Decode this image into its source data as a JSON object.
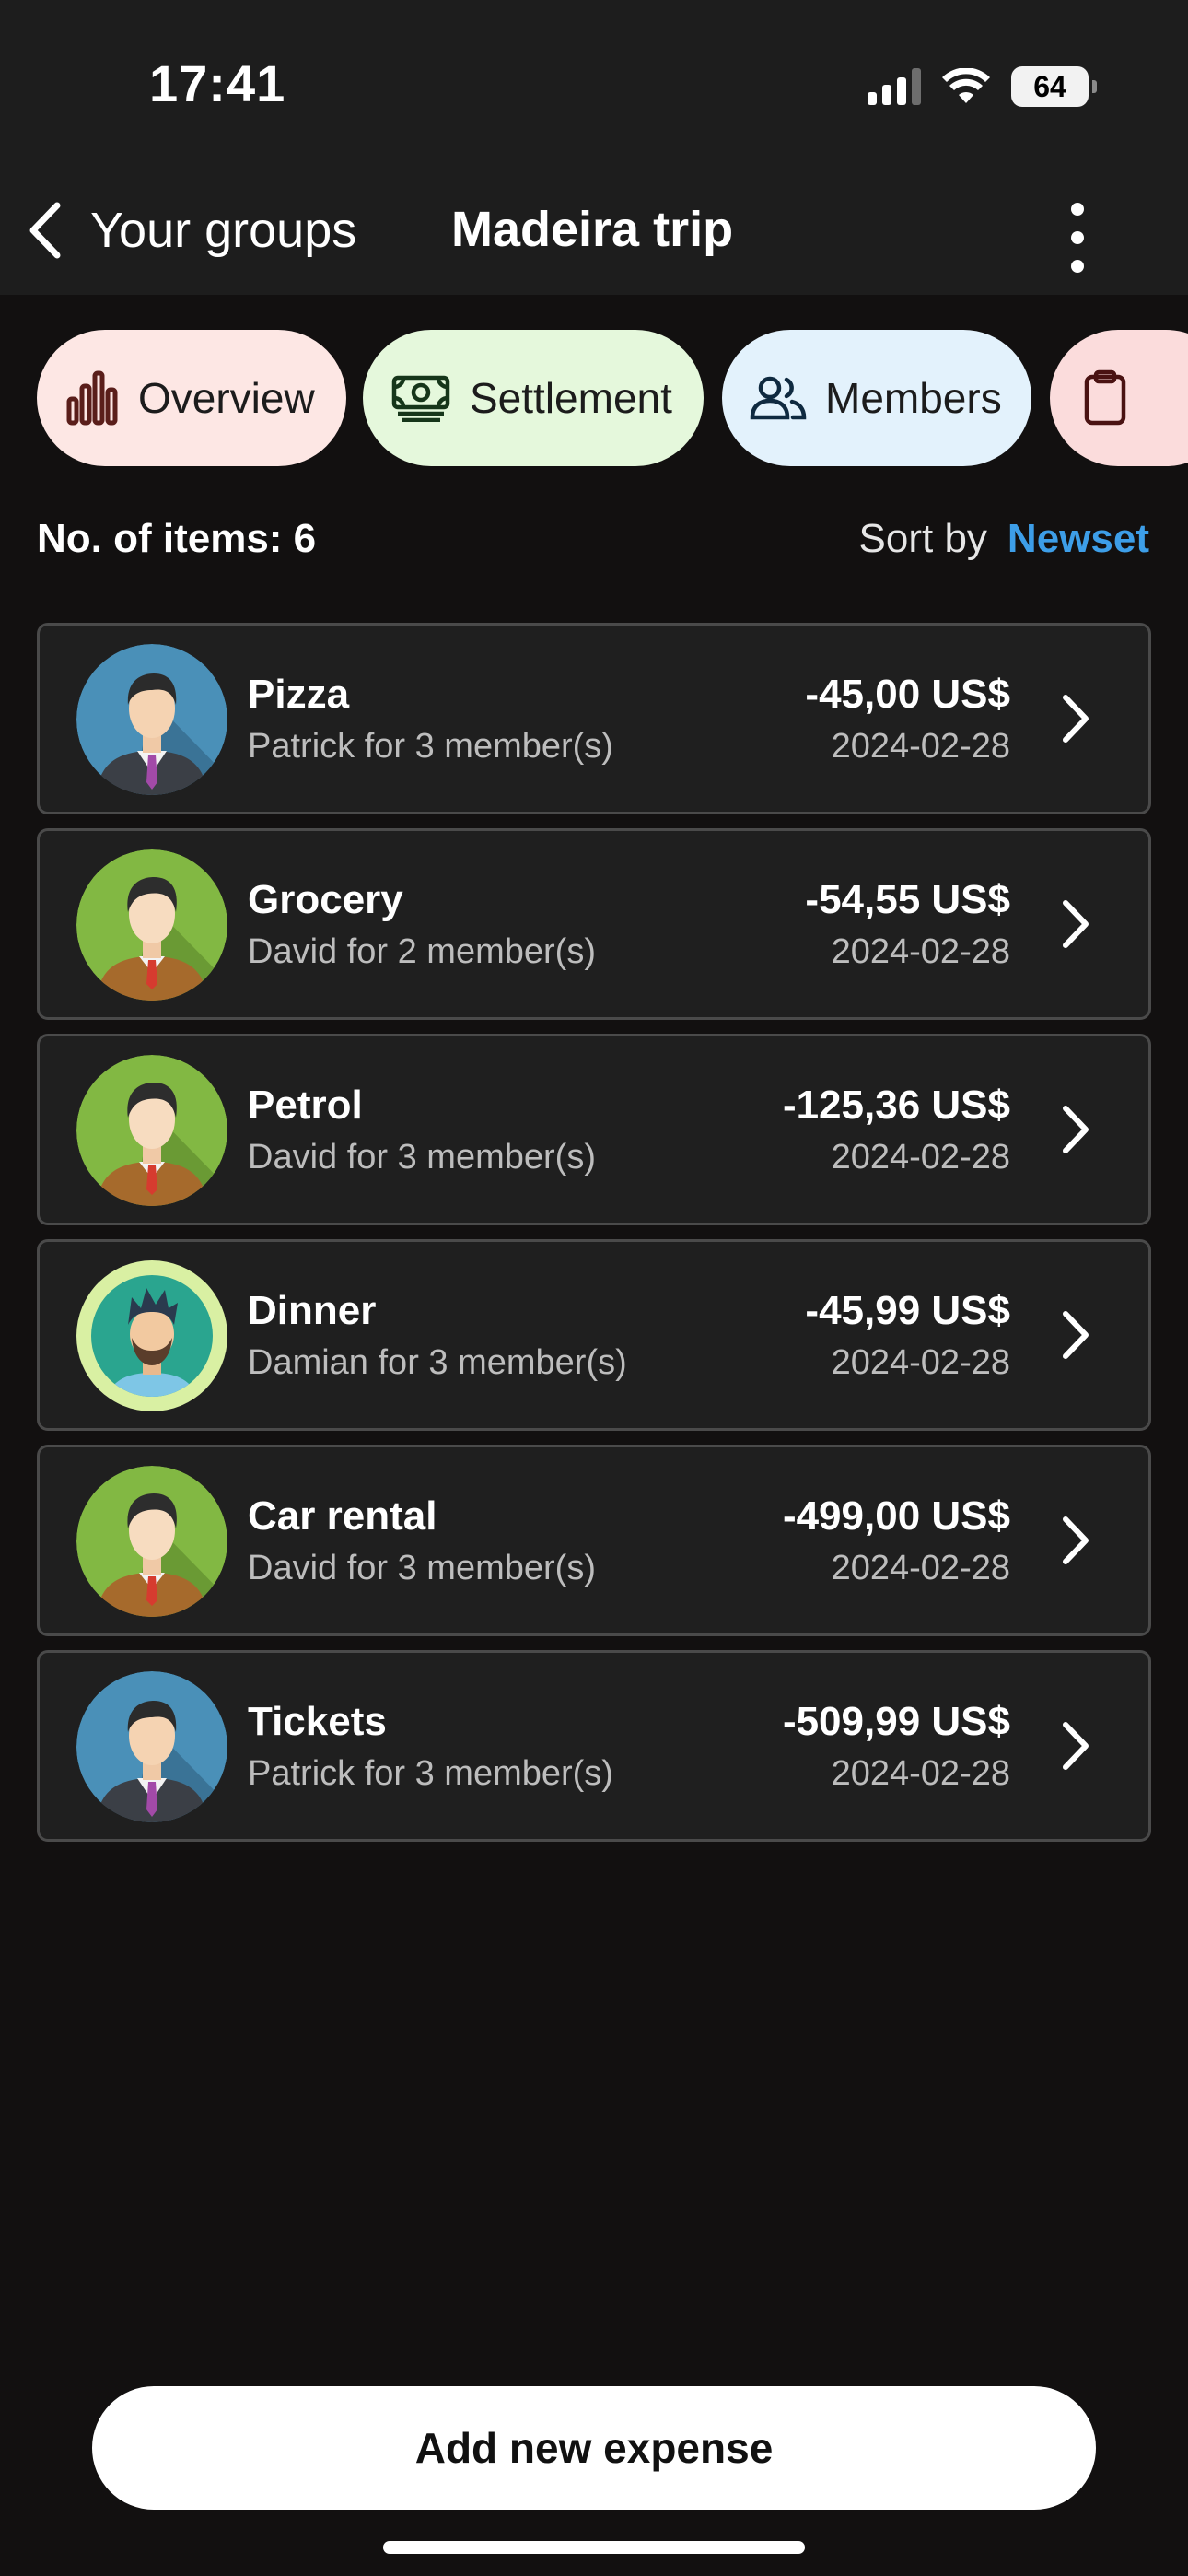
{
  "status_bar": {
    "time": "17:41",
    "battery": "64",
    "signal_icon": "cellular-signal-icon",
    "wifi_icon": "wifi-icon"
  },
  "header": {
    "back_label": "Your groups",
    "title": "Madeira trip",
    "back_icon": "chevron-left-icon",
    "menu_icon": "more-vertical-icon"
  },
  "tabs": [
    {
      "label": "Overview",
      "icon": "bar-chart-icon",
      "color": "#fde7e4"
    },
    {
      "label": "Settlement",
      "icon": "banknote-icon",
      "color": "#e5f8dc"
    },
    {
      "label": "Members",
      "icon": "users-icon",
      "color": "#e3f2fc"
    },
    {
      "label": "",
      "icon": "clipboard-icon",
      "color": "#fbdcdc"
    }
  ],
  "list_header": {
    "count_label": "No. of items: 6",
    "sort_label": "Sort by",
    "sort_value": "Newset"
  },
  "expenses": [
    {
      "title": "Pizza",
      "subtitle": "Patrick for 3 member(s)",
      "amount": "-45,00 US$",
      "date": "2024-02-28",
      "avatar": "patrick"
    },
    {
      "title": "Grocery",
      "subtitle": "David for 2 member(s)",
      "amount": "-54,55 US$",
      "date": "2024-02-28",
      "avatar": "david"
    },
    {
      "title": "Petrol",
      "subtitle": "David for 3 member(s)",
      "amount": "-125,36 US$",
      "date": "2024-02-28",
      "avatar": "david"
    },
    {
      "title": "Dinner",
      "subtitle": "Damian for 3 member(s)",
      "amount": "-45,99 US$",
      "date": "2024-02-28",
      "avatar": "damian"
    },
    {
      "title": "Car rental",
      "subtitle": "David for 3 member(s)",
      "amount": "-499,00 US$",
      "date": "2024-02-28",
      "avatar": "david"
    },
    {
      "title": "Tickets",
      "subtitle": "Patrick for 3 member(s)",
      "amount": "-509,99 US$",
      "date": "2024-02-28",
      "avatar": "patrick"
    }
  ],
  "actions": {
    "add_expense_label": "Add new expense"
  },
  "colors": {
    "accent": "#3d9ee8",
    "background": "#121010",
    "card": "#1f1f1f"
  }
}
